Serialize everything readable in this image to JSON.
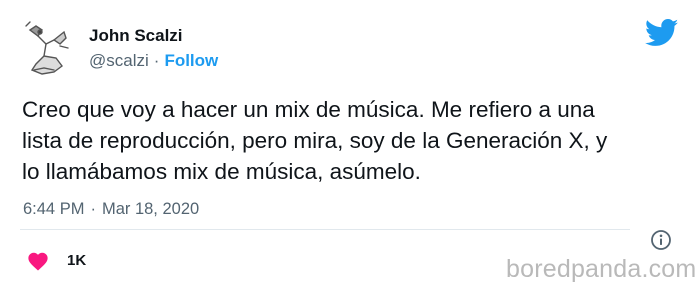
{
  "author": {
    "name": "John Scalzi",
    "handle": "@scalzi",
    "separator": "·",
    "follow_label": "Follow"
  },
  "tweet": {
    "text": "Creo que voy a hacer un mix de música. Me refiero a una\nlista de reproducción, pero mira, soy de la Generación X, y\nlo llamábamos mix de música, asúmelo.",
    "time": "6:44 PM",
    "separator": "·",
    "date": "Mar 18, 2020"
  },
  "engagement": {
    "likes": "1K"
  },
  "watermark": "boredpanda.com",
  "icons": {
    "platform": "twitter-bird-icon",
    "info": "info-icon",
    "like": "heart-icon"
  },
  "colors": {
    "accent": "#1d9bf0",
    "heart": "#f91880",
    "muted_text": "#536471"
  }
}
